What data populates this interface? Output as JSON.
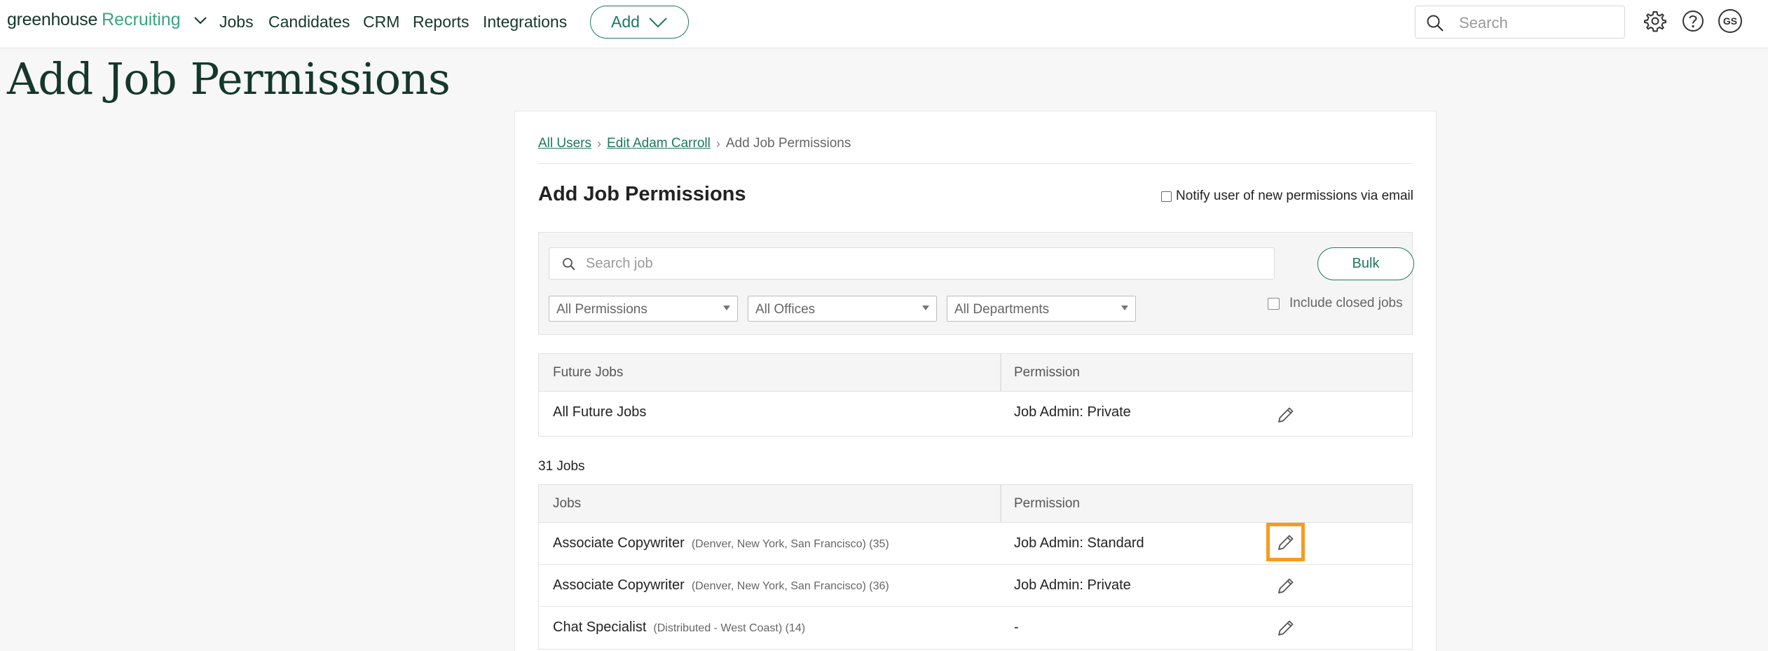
{
  "nav": {
    "logo_main": "greenhouse",
    "logo_product": "Recruiting",
    "links": [
      "Jobs",
      "Candidates",
      "CRM",
      "Reports",
      "Integrations"
    ],
    "add_label": "Add",
    "search_placeholder": "Search",
    "avatar_initials": "GS"
  },
  "page_title": "Add Job Permissions",
  "breadcrumb": {
    "all_users": "All Users",
    "edit_user": "Edit Adam Carroll",
    "current": "Add Job Permissions"
  },
  "section_title": "Add Job Permissions",
  "notify_label": "Notify user of new permissions via email",
  "filters": {
    "search_placeholder": "Search job",
    "bulk_label": "Bulk",
    "permissions_select": "All Permissions",
    "offices_select": "All Offices",
    "departments_select": "All Departments",
    "include_closed_label": "Include closed jobs"
  },
  "future_jobs": {
    "col_jobs": "Future Jobs",
    "col_permission": "Permission",
    "rows": [
      {
        "name": "All Future Jobs",
        "permission": "Job Admin: Private"
      }
    ]
  },
  "jobs_count": "31 Jobs",
  "jobs": {
    "col_jobs": "Jobs",
    "col_permission": "Permission",
    "rows": [
      {
        "name": "Associate Copywriter",
        "meta": "(Denver, New York, San Francisco) (35)",
        "permission": "Job Admin: Standard"
      },
      {
        "name": "Associate Copywriter",
        "meta": "(Denver, New York, San Francisco) (36)",
        "permission": "Job Admin: Private"
      },
      {
        "name": "Chat Specialist",
        "meta": "(Distributed - West Coast) (14)",
        "permission": "-"
      }
    ]
  },
  "colors": {
    "brand_dark": "#15372c",
    "brand_green": "#1d7a59",
    "highlight_orange": "#f89a1e"
  },
  "icons": [
    "chevron-down-icon",
    "search-icon",
    "gear-icon",
    "help-icon",
    "pencil-icon"
  ]
}
